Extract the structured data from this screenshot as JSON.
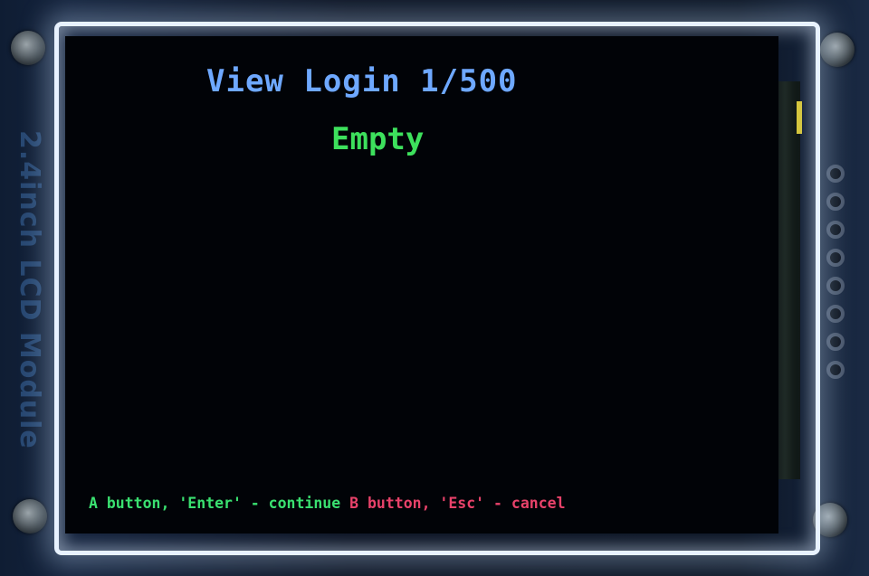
{
  "device": {
    "module_label": "2.4inch LCD Module",
    "accent_color": "#6ea8ff"
  },
  "screen": {
    "title": "View Login 1/500",
    "status": "Empty",
    "status_color": "#3de05c",
    "footer": {
      "continue_hint": "A button, 'Enter' - continue",
      "cancel_hint": "B button, 'Esc' - cancel",
      "continue_color": "#3ae070",
      "cancel_color": "#e8426a"
    }
  }
}
